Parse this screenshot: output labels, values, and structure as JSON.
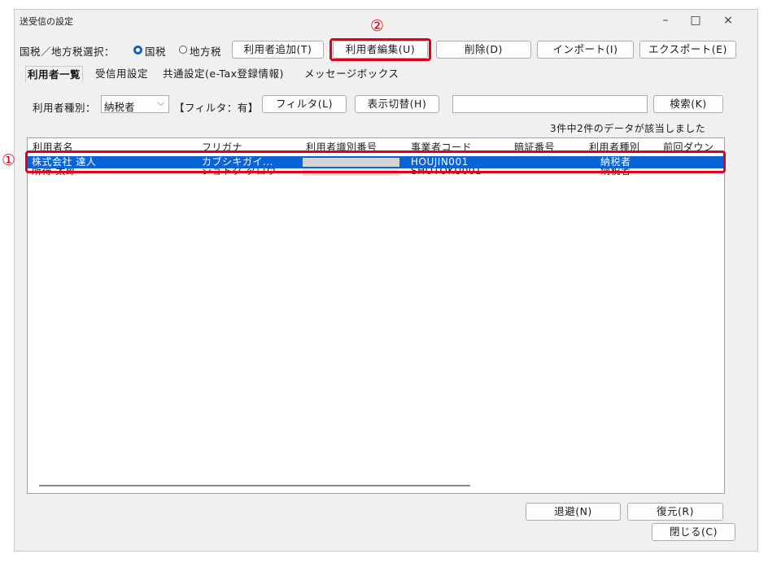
{
  "window": {
    "title": "送受信の設定",
    "minimize": "–",
    "maximize": "□",
    "close": "×"
  },
  "toolbar": {
    "tax_select_label": "国税／地方税選択：",
    "national_tax": "国税",
    "local_tax": "地方税",
    "add_user": "利用者追加(T)",
    "edit_user": "利用者編集(U)",
    "delete": "削除(D)",
    "import": "インポート(I)",
    "export": "エクスポート(E)"
  },
  "tabs": [
    "利用者一覧",
    "受信用設定",
    "共通設定(e-Tax登録情報)",
    "メッセージボックス"
  ],
  "filter": {
    "user_type_label": "利用者種別：",
    "user_type_value": "納税者",
    "filter_state": "【フィルタ：有】",
    "filter_button": "フィルタ(L)",
    "toggle_button": "表示切替(H)",
    "search_button": "検索(K)",
    "count_text": "3件中2件のデータが該当しました"
  },
  "table": {
    "columns": [
      "利用者名",
      "フリガナ",
      "利用者識別番号",
      "事業者コード",
      "暗証番号",
      "利用者種別",
      "前回ダウン"
    ],
    "rows": [
      [
        "株式会社 達人",
        "カブシキガイ...",
        "",
        "HOUJIN001",
        "",
        "納税者",
        ""
      ],
      [
        "所得 太郎",
        "ショトク タロウ",
        "",
        "SHOTOKU001",
        "",
        "納税者",
        ""
      ]
    ]
  },
  "bottom": {
    "evacuate": "退避(N)",
    "restore": "復元(R)",
    "close": "閉じる(C)"
  },
  "annotations": {
    "marker1": "①",
    "marker2": "②"
  },
  "colors": {
    "selection": "#0a64d6",
    "highlight": "#e0001b",
    "radio_on": "#1e5fb4"
  }
}
